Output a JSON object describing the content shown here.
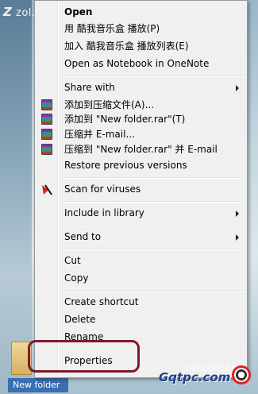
{
  "desktop": {
    "watermark_top": "zol.com.cn",
    "watermark_top_mark": "Z",
    "folder_caption": "New folder",
    "watermark_bottom": "Gqtpc.com",
    "watermark_bottom_small": "zol.com.cn"
  },
  "menu": {
    "items": [
      {
        "label": "Open",
        "bold": true
      },
      {
        "label": "用 酷我音乐盒 播放(P)"
      },
      {
        "label": "加入 酷我音乐盒 播放列表(E)"
      },
      {
        "label": "Open as Notebook in OneNote"
      },
      {
        "label": "Share with",
        "submenu": true
      },
      {
        "label": "添加到压缩文件(A)...",
        "icon": "winrar-icon"
      },
      {
        "label": "添加到 \"New folder.rar\"(T)",
        "icon": "winrar-icon"
      },
      {
        "label": "压缩并 E-mail...",
        "icon": "winrar-icon"
      },
      {
        "label": "压缩到 \"New folder.rar\" 并 E-mail",
        "icon": "winrar-icon"
      },
      {
        "label": "Restore previous versions"
      },
      {
        "label": "Scan for viruses",
        "icon": "antivirus-icon"
      },
      {
        "label": "Include in library",
        "submenu": true
      },
      {
        "label": "Send to",
        "submenu": true
      },
      {
        "label": "Cut"
      },
      {
        "label": "Copy"
      },
      {
        "label": "Create shortcut"
      },
      {
        "label": "Delete"
      },
      {
        "label": "Rename"
      },
      {
        "label": "Properties"
      }
    ]
  },
  "colors": {
    "menu_bg": "#f0f0f0",
    "highlight_ring": "#7d1a2c"
  }
}
